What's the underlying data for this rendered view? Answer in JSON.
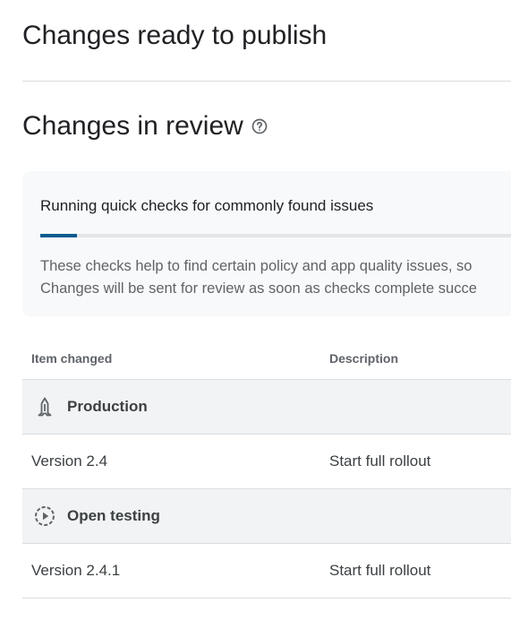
{
  "header": {
    "ready_title": "Changes ready to publish",
    "review_title": "Changes in review",
    "help_icon": "help-circle-icon"
  },
  "checks": {
    "title": "Running quick checks for commonly found issues",
    "progress_fraction": 0.075,
    "accent_color": "#0b5b8f",
    "desc_line1": "These checks help to find certain policy and app quality issues, so",
    "desc_line2": "Changes will be sent for review as soon as checks complete succe"
  },
  "table": {
    "headers": {
      "item_changed": "Item changed",
      "description": "Description"
    },
    "groups": [
      {
        "label": "Production",
        "icon": "production-track-icon",
        "items": [
          {
            "item": "Version 2.4",
            "description": "Start full rollout"
          }
        ]
      },
      {
        "label": "Open testing",
        "icon": "open-testing-icon",
        "items": [
          {
            "item": "Version 2.4.1",
            "description": "Start full rollout"
          }
        ]
      }
    ]
  }
}
